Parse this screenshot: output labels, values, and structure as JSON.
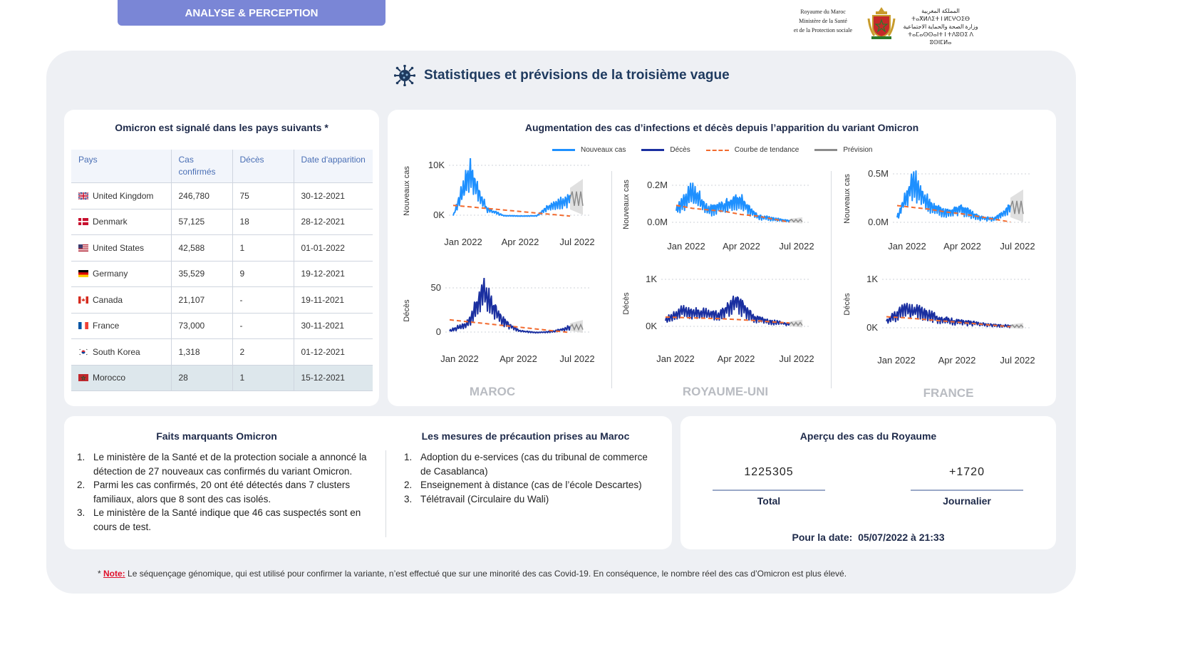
{
  "header": {
    "tab_label": "ANALYSE & PERCEPTION",
    "gov_fr": [
      "Royaume du Maroc",
      "Ministère de la Santé",
      "et de la Protection sociale"
    ],
    "gov_ar": [
      "المملكة المغربية",
      "ⵜⴰⴳⵍⴷⵉⵜ ⵏ ⵍⵎⵖⵔⵉⴱ",
      "وزارة الصحة والحماية الاجتماعية",
      "ⵜⴰⵎⴰⵙⵙⴰⵏⵜ ⵏ ⵜⴷⵓⵙⵉ ⴷ ⵓⵙⵏⵎⵍⴰ"
    ]
  },
  "main_title": "Statistiques et prévisions de la troisième vague",
  "countries": {
    "title": "Omicron est signalé dans les pays suivants *",
    "headers": [
      "Pays",
      "Cas confirmés",
      "Décès",
      "Date d'apparition"
    ],
    "rows": [
      {
        "flag": "uk",
        "name": "United Kingdom",
        "cases": "246,780",
        "deaths": "75",
        "date": "30-12-2021"
      },
      {
        "flag": "dk",
        "name": "Denmark",
        "cases": "57,125",
        "deaths": "18",
        "date": "28-12-2021"
      },
      {
        "flag": "us",
        "name": "United States",
        "cases": "42,588",
        "deaths": "1",
        "date": "01-01-2022"
      },
      {
        "flag": "de",
        "name": "Germany",
        "cases": "35,529",
        "deaths": "9",
        "date": "19-12-2021"
      },
      {
        "flag": "ca",
        "name": "Canada",
        "cases": "21,107",
        "deaths": "-",
        "date": "19-11-2021"
      },
      {
        "flag": "fr",
        "name": "France",
        "cases": "73,000",
        "deaths": "-",
        "date": "30-11-2021"
      },
      {
        "flag": "kr",
        "name": "South Korea",
        "cases": "1,318",
        "deaths": "2",
        "date": "01-12-2021"
      },
      {
        "flag": "ma",
        "name": "Morocco",
        "cases": "28",
        "deaths": "1",
        "date": "15-12-2021"
      }
    ]
  },
  "charts_card": {
    "title": "Augmentation des cas d’infections et décès depuis l’apparition du variant Omicron",
    "legend": [
      {
        "label": "Nouveaux cas",
        "color": "#1e90ff",
        "style": "solid"
      },
      {
        "label": "Décès",
        "color": "#1a2fa0",
        "style": "solid"
      },
      {
        "label": "Courbe de tendance",
        "color": "#f26a2e",
        "style": "dashed"
      },
      {
        "label": "Prévision",
        "color": "#8c8c8c",
        "style": "solid"
      }
    ],
    "countries": [
      "MAROC",
      "ROYAUME-UNI",
      "FRANCE"
    ]
  },
  "chart_data": [
    {
      "type": "line",
      "title": "MAROC",
      "ylabel": "Nouveaux cas",
      "yticks": [
        "0K",
        "10K"
      ],
      "ylim": [
        0,
        10000
      ],
      "xticks": [
        "Jan 2022",
        "Apr 2022",
        "Jul 2022"
      ],
      "x": [
        "2021-12",
        "2022-01",
        "2022-02",
        "2022-03",
        "2022-04",
        "2022-05",
        "2022-06",
        "2022-07"
      ],
      "series": [
        {
          "name": "Nouveaux cas",
          "values": [
            200,
            8500,
            1500,
            200,
            100,
            150,
            2500,
            3500
          ]
        },
        {
          "name": "Courbe de tendance",
          "values": [
            2200,
            1900,
            1600,
            1300,
            1000,
            700,
            400,
            100
          ]
        }
      ]
    },
    {
      "type": "line",
      "title": "MAROC",
      "ylabel": "Décès",
      "yticks": [
        "0",
        "50"
      ],
      "ylim": [
        0,
        50
      ],
      "xticks": [
        "Jan 2022",
        "Apr 2022",
        "Jul 2022"
      ],
      "x": [
        "2021-12",
        "2022-01",
        "2022-02",
        "2022-03",
        "2022-04",
        "2022-05",
        "2022-06",
        "2022-07"
      ],
      "series": [
        {
          "name": "Décès",
          "values": [
            3,
            10,
            45,
            15,
            3,
            1,
            2,
            7
          ]
        },
        {
          "name": "Courbe de tendance",
          "values": [
            15,
            13,
            11,
            9,
            7,
            5,
            3,
            1
          ]
        }
      ]
    },
    {
      "type": "line",
      "title": "ROYAUME-UNI",
      "ylabel": "Nouveaux cas",
      "yticks": [
        "0.0M",
        "0.2M"
      ],
      "ylim": [
        0,
        0.25
      ],
      "xticks": [
        "Jan 2022",
        "Apr 2022",
        "Jul 2022"
      ],
      "x": [
        "2021-12",
        "2022-01",
        "2022-02",
        "2022-03",
        "2022-04",
        "2022-05",
        "2022-06",
        "2022-07"
      ],
      "series": [
        {
          "name": "Nouveaux cas",
          "values": [
            0.08,
            0.2,
            0.09,
            0.12,
            0.15,
            0.05,
            0.03,
            0.02
          ]
        },
        {
          "name": "Courbe de tendance",
          "values": [
            0.12,
            0.1,
            0.09,
            0.08,
            0.06,
            0.05,
            0.03,
            0.01
          ]
        }
      ]
    },
    {
      "type": "line",
      "title": "ROYAUME-UNI",
      "ylabel": "Décès",
      "yticks": [
        "0K",
        "1K"
      ],
      "ylim": [
        0,
        1000
      ],
      "xticks": [
        "Jan 2022",
        "Apr 2022",
        "Jul 2022"
      ],
      "x": [
        "2021-12",
        "2022-01",
        "2022-02",
        "2022-03",
        "2022-04",
        "2022-05",
        "2022-06",
        "2022-07"
      ],
      "series": [
        {
          "name": "Décès",
          "values": [
            150,
            350,
            300,
            250,
            550,
            200,
            120,
            80
          ]
        },
        {
          "name": "Courbe de tendance",
          "values": [
            220,
            210,
            200,
            190,
            170,
            150,
            120,
            100
          ]
        }
      ]
    },
    {
      "type": "line",
      "title": "FRANCE",
      "ylabel": "Nouveaux cas",
      "yticks": [
        "0.0M",
        "0.5M"
      ],
      "ylim": [
        0,
        0.55
      ],
      "xticks": [
        "Jan 2022",
        "Apr 2022",
        "Jul 2022"
      ],
      "x": [
        "2021-12",
        "2022-01",
        "2022-02",
        "2022-03",
        "2022-04",
        "2022-05",
        "2022-06",
        "2022-07"
      ],
      "series": [
        {
          "name": "Nouveaux cas",
          "values": [
            0.08,
            0.45,
            0.2,
            0.12,
            0.17,
            0.07,
            0.05,
            0.18
          ]
        },
        {
          "name": "Courbe de tendance",
          "values": [
            0.2,
            0.18,
            0.16,
            0.13,
            0.11,
            0.08,
            0.05,
            0.02
          ]
        }
      ]
    },
    {
      "type": "line",
      "title": "FRANCE",
      "ylabel": "Décès",
      "yticks": [
        "0K",
        "1K"
      ],
      "ylim": [
        0,
        1000
      ],
      "xticks": [
        "Jan 2022",
        "Apr 2022",
        "Jul 2022"
      ],
      "x": [
        "2021-12",
        "2022-01",
        "2022-02",
        "2022-03",
        "2022-04",
        "2022-05",
        "2022-06",
        "2022-07"
      ],
      "series": [
        {
          "name": "Décès",
          "values": [
            150,
            400,
            350,
            200,
            150,
            120,
            80,
            60
          ]
        },
        {
          "name": "Courbe de tendance",
          "values": [
            250,
            230,
            200,
            170,
            140,
            110,
            80,
            50
          ]
        }
      ]
    }
  ],
  "facts": {
    "title": "Faits marquants Omicron",
    "items": [
      "Le ministère de la Santé et de la protection sociale a annoncé la détection de 27 nouveaux cas confirmés du variant Omicron.",
      "Parmi les cas confirmés, 20 ont été détectés dans 7 clusters familiaux, alors que 8 sont des cas isolés.",
      "Le ministère de la Santé indique que 46 cas suspectés sont en cours de test."
    ]
  },
  "measures": {
    "title": "Les mesures de précaution prises au Maroc",
    "items": [
      "Adoption du e-services (cas du tribunal de commerce de Casablanca)",
      "Enseignement à distance (cas de l’école Descartes)",
      "Télétravail (Circulaire du Wali)"
    ]
  },
  "overview": {
    "title": "Aperçu des cas du Royaume",
    "total_value": "1225305",
    "total_label": "Total",
    "daily_value": "+1720",
    "daily_label": "Journalier",
    "date_label": "Pour la date:",
    "date_value": "05/07/2022 à 21:33"
  },
  "note": {
    "label": "Note:",
    "text": "Le séquençage génomique, qui est utilisé pour confirmer la variante, n’est effectué que sur une minorité des cas Covid-19. En conséquence, le nombre réel des cas d’Omicron est plus élevé."
  }
}
